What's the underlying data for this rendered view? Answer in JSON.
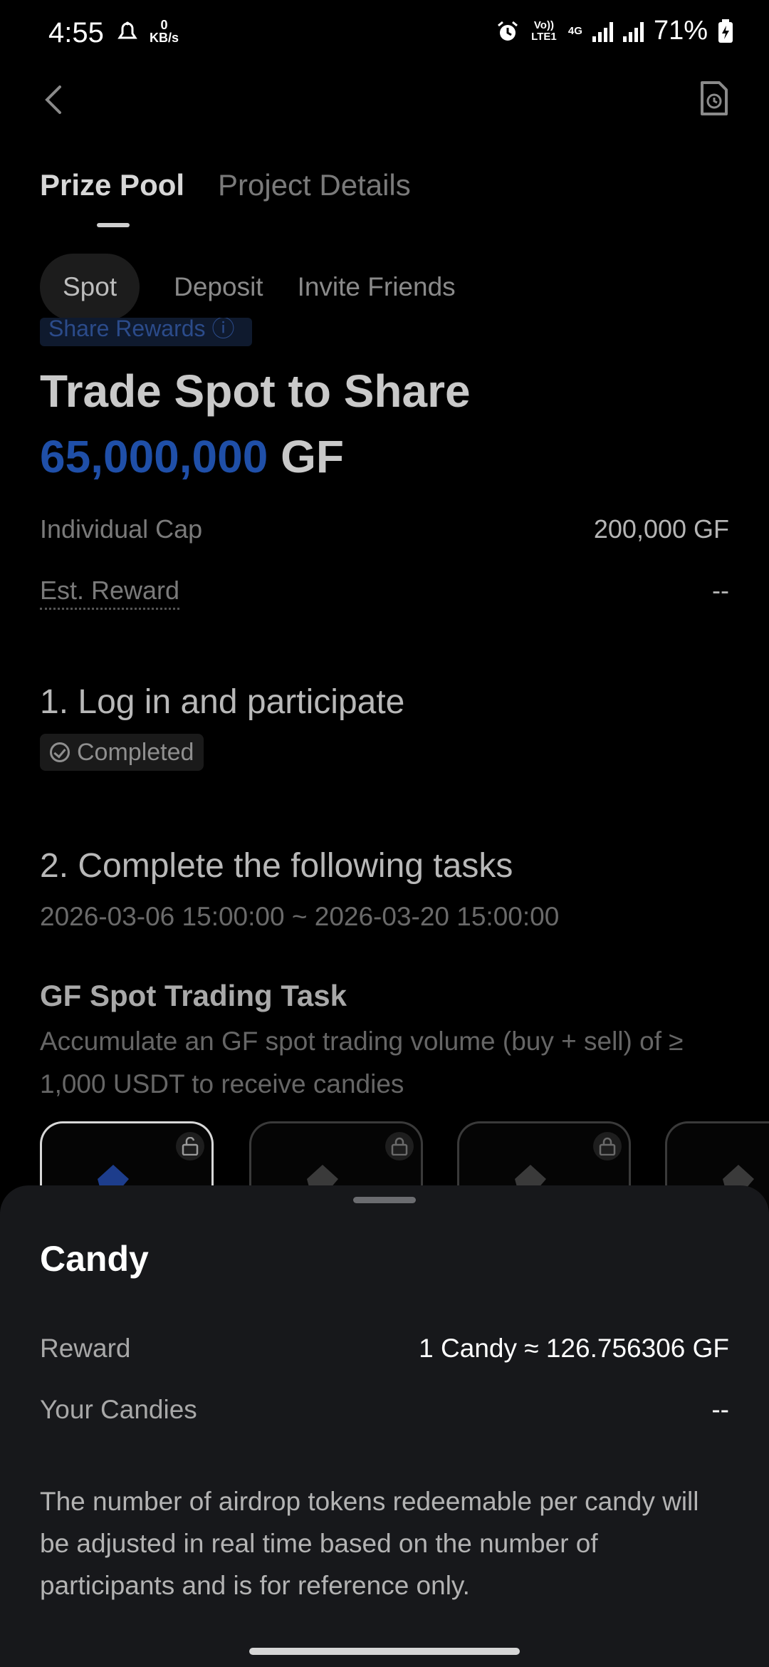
{
  "status_bar": {
    "time": "4:55",
    "net_speed_value": "0",
    "net_speed_unit": "KB/s",
    "volte": "Vo)) LTE1",
    "network": "4G",
    "battery": "71%"
  },
  "tabs": [
    {
      "label": "Prize Pool"
    },
    {
      "label": "Project Details"
    }
  ],
  "filters": [
    "Spot",
    "Deposit",
    "Invite Friends"
  ],
  "ribbon_label": "Share Rewards ⓘ",
  "heading": {
    "title": "Trade Spot to Share",
    "amount": "65,000,000",
    "unit": "GF"
  },
  "stats": {
    "individual_cap_label": "Individual Cap",
    "individual_cap_value": "200,000 GF",
    "est_reward_label": "Est. Reward",
    "est_reward_value": "--"
  },
  "step1": {
    "title": "1. Log in and participate",
    "status": "Completed"
  },
  "step2": {
    "title": "2. Complete the following tasks",
    "dates": "2026-03-06 15:00:00 ~ 2026-03-20 15:00:00"
  },
  "task": {
    "title": "GF Spot Trading Task",
    "description": "Accumulate an GF spot trading volume (buy + sell) of ≥ 1,000 USDT to receive candies"
  },
  "colors": {
    "accent_blue": "#1f4fa8",
    "sheet_bg": "#17181b"
  },
  "sheet": {
    "title": "Candy",
    "reward_label": "Reward",
    "reward_value": "1 Candy ≈ 126.756306 GF",
    "your_candies_label": "Your Candies",
    "your_candies_value": "--",
    "note": "The number of airdrop tokens redeemable per candy will be adjusted in real time based on the number of participants and is for reference only."
  }
}
